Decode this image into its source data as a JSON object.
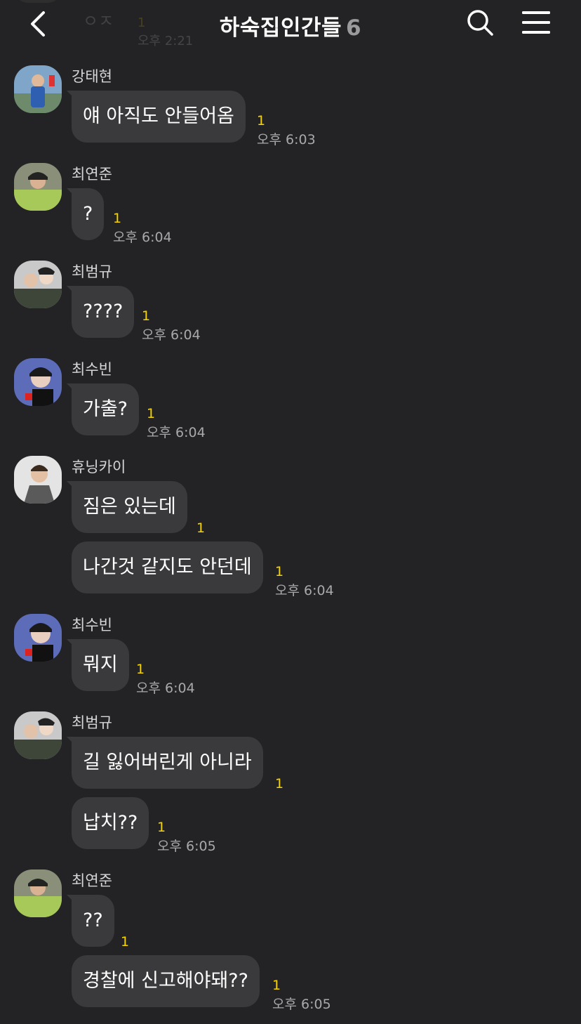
{
  "header": {
    "title": "하숙집인간들",
    "member_count": "6"
  },
  "ghost_message": {
    "text": "ㅇㅈ",
    "unread": "1",
    "time": "오후 2:21"
  },
  "messages": [
    {
      "sender": "강태현",
      "text": "얘 아직도 안들어옴",
      "unread": "1",
      "time": "오후 6:03"
    },
    {
      "sender": "최연준",
      "text": "?",
      "unread": "1",
      "time": "오후 6:04"
    },
    {
      "sender": "최범규",
      "text": "????",
      "unread": "1",
      "time": "오후 6:04"
    },
    {
      "sender": "최수빈",
      "text": "가출?",
      "unread": "1",
      "time": "오후 6:04"
    },
    {
      "sender": "휴닝카이",
      "text": "짐은 있는데",
      "unread": "1"
    },
    {
      "text": "나간것 같지도 안던데",
      "unread": "1",
      "time": "오후 6:04"
    },
    {
      "sender": "최수빈",
      "text": "뭐지",
      "unread": "1",
      "time": "오후 6:04"
    },
    {
      "sender": "최범규",
      "text": "길 잃어버린게 아니라",
      "unread": "1"
    },
    {
      "text": "납치??",
      "unread": "1",
      "time": "오후 6:05"
    },
    {
      "sender": "최연준",
      "text": "??",
      "unread": "1"
    },
    {
      "text": "경찰에 신고해야돼??",
      "unread": "1",
      "time": "오후 6:05"
    }
  ],
  "colors": {
    "background": "#232325",
    "bubble": "#3a3a3c",
    "unread": "#f6d400",
    "time": "#a9a9ab"
  }
}
